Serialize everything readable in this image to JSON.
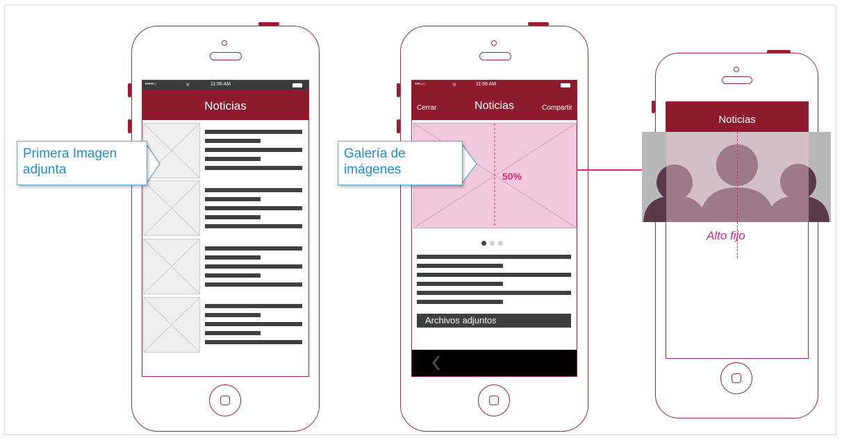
{
  "phone1": {
    "status": {
      "carrier": "•••••○",
      "wifi": "ᯤ",
      "time": "11:56 AM"
    },
    "title": "Noticias",
    "callout": {
      "line1": "Primera Imagen",
      "line2": "adjunta"
    }
  },
  "phone2": {
    "status": {
      "carrier": "•••○○",
      "wifi": "ᯤ",
      "time": "11:56 AM"
    },
    "close": "Cerrar",
    "title": "Noticias",
    "share": "Compartir",
    "percent": "50%",
    "attachments": "Archivos adjuntos",
    "back_icon": "chevron-left-icon",
    "callout": {
      "line1": "Galería de",
      "line2": "imágenes"
    }
  },
  "phone3": {
    "title": "Noticias",
    "caption": "Alto fijo"
  },
  "colors": {
    "brand": "#8e1a2e",
    "outline": "#9e2a3d",
    "callout_text": "#1d8ed4",
    "accent": "#e0218a",
    "gallery_fill": "#f2c9dc"
  }
}
